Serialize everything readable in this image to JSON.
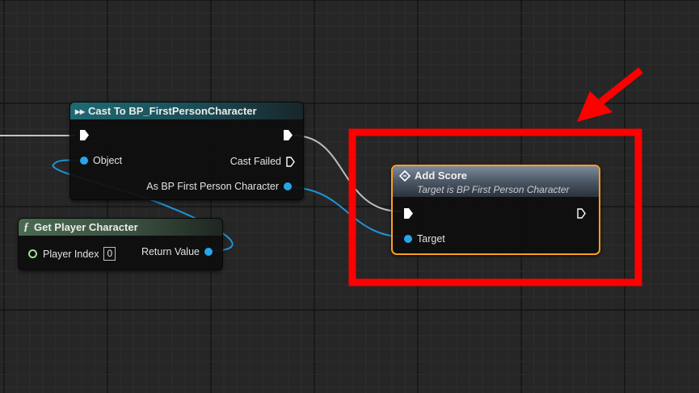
{
  "colors": {
    "background": "#262626",
    "data_pin": "#26a6e8",
    "exec_pin": "#ffffff",
    "cast_header": "#1e5d66",
    "function_header": "#3f5a44",
    "add_score_header": "#6c7b8c",
    "selection_border": "#ff9f1c",
    "highlight_box": "#ff0000",
    "wire_data": "#1f93d6",
    "wire_exec": "#bdbdbd"
  },
  "cast_node": {
    "title": "Cast To BP_FirstPersonCharacter",
    "icon": "cast-arrows-icon",
    "object_label": "Object",
    "cast_failed_label": "Cast Failed",
    "as_label": "As BP First Person Character"
  },
  "get_player_node": {
    "title": "Get Player Character",
    "icon": "function-f-icon",
    "player_index_label": "Player Index",
    "player_index_value": "0",
    "return_label": "Return Value"
  },
  "add_score_node": {
    "title": "Add Score",
    "subtitle": "Target is BP First Person Character",
    "icon": "event-diamond-icon",
    "target_label": "Target",
    "selected": true
  },
  "annotations": {
    "highlight_box": "red-highlight-rectangle",
    "arrow": "red-pointer-arrow"
  }
}
